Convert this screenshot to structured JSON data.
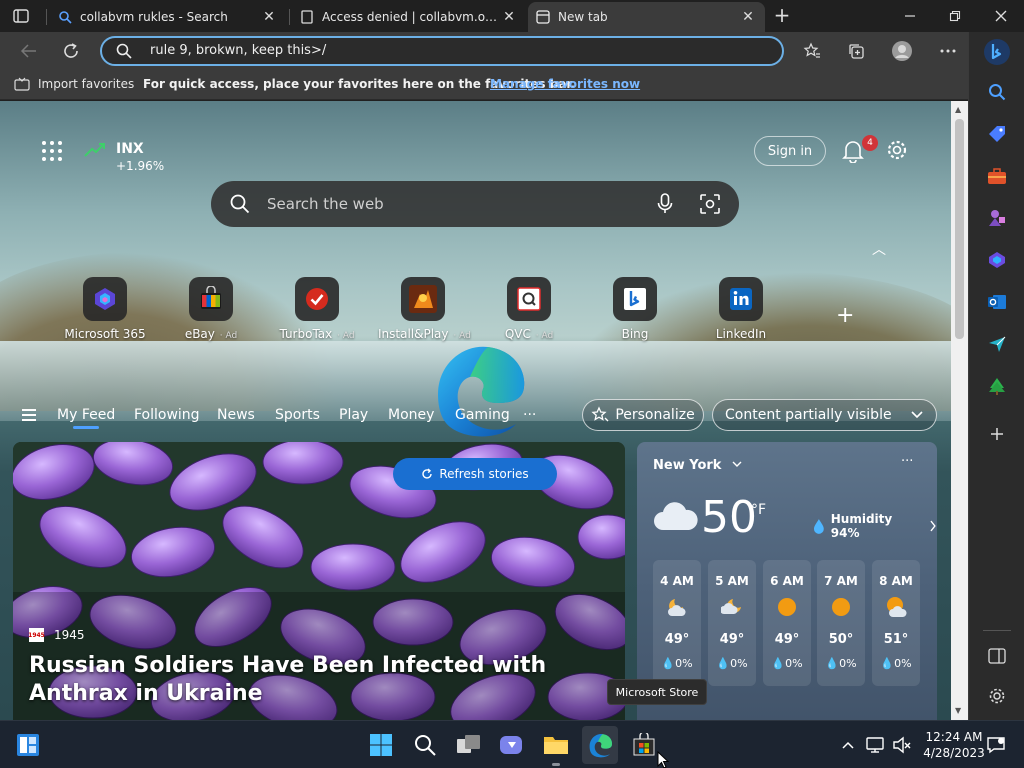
{
  "tabs": [
    {
      "title": "collabvm rukles - Search",
      "active": false
    },
    {
      "title": "Access denied | collabvm.org use",
      "active": false
    },
    {
      "title": "New tab",
      "active": true
    }
  ],
  "address_bar": {
    "value": "rule 9, brokwn, keep this>/"
  },
  "favorites_bar": {
    "import_label": "Import favorites",
    "hint": "For quick access, place your favorites here on the favorites bar.",
    "manage_link": "Manage favorites now"
  },
  "stock": {
    "symbol": "INX",
    "change": "+1.96%"
  },
  "header": {
    "signin_label": "Sign in",
    "notification_count": "4"
  },
  "search": {
    "placeholder": "Search the web"
  },
  "quick_links": [
    {
      "label": "Microsoft 365",
      "ad": ""
    },
    {
      "label": "eBay",
      "ad": "Ad"
    },
    {
      "label": "TurboTax",
      "ad": "Ad"
    },
    {
      "label": "Install&Play",
      "ad": "Ad"
    },
    {
      "label": "QVC",
      "ad": "Ad"
    },
    {
      "label": "Bing",
      "ad": ""
    },
    {
      "label": "LinkedIn",
      "ad": ""
    }
  ],
  "feed_nav": {
    "items": [
      "My Feed",
      "Following",
      "News",
      "Sports",
      "Play",
      "Money",
      "Gaming"
    ],
    "more": "···",
    "personalize": "Personalize",
    "content_visibility": "Content partially visible"
  },
  "refresh_label": "Refresh stories",
  "hero": {
    "source": "1945",
    "source_logo_text": "1945",
    "headline": "Russian Soldiers Have Been Infected with Anthrax in Ukraine"
  },
  "weather": {
    "city": "New York",
    "more": "···",
    "temperature": "50",
    "unit": "°F",
    "humidity": "Humidity 94%",
    "hourly": [
      {
        "time": "4 AM",
        "temp": "49°",
        "precip": "0%",
        "icon": "partly-cloudy-night"
      },
      {
        "time": "5 AM",
        "temp": "49°",
        "precip": "0%",
        "icon": "partly-cloudy-night"
      },
      {
        "time": "6 AM",
        "temp": "49°",
        "precip": "0%",
        "icon": "sunny"
      },
      {
        "time": "7 AM",
        "temp": "50°",
        "precip": "0%",
        "icon": "sunny"
      },
      {
        "time": "8 AM",
        "temp": "51°",
        "precip": "0%",
        "icon": "partly-cloudy-day"
      }
    ]
  },
  "tooltip": "Microsoft Store",
  "clock": {
    "time": "12:24 AM",
    "date": "4/28/2023"
  },
  "colors": {
    "accent": "#1a6fd1",
    "tab_active": "#3b3b3b",
    "link": "#7ab7ff",
    "badge": "#d13438"
  }
}
